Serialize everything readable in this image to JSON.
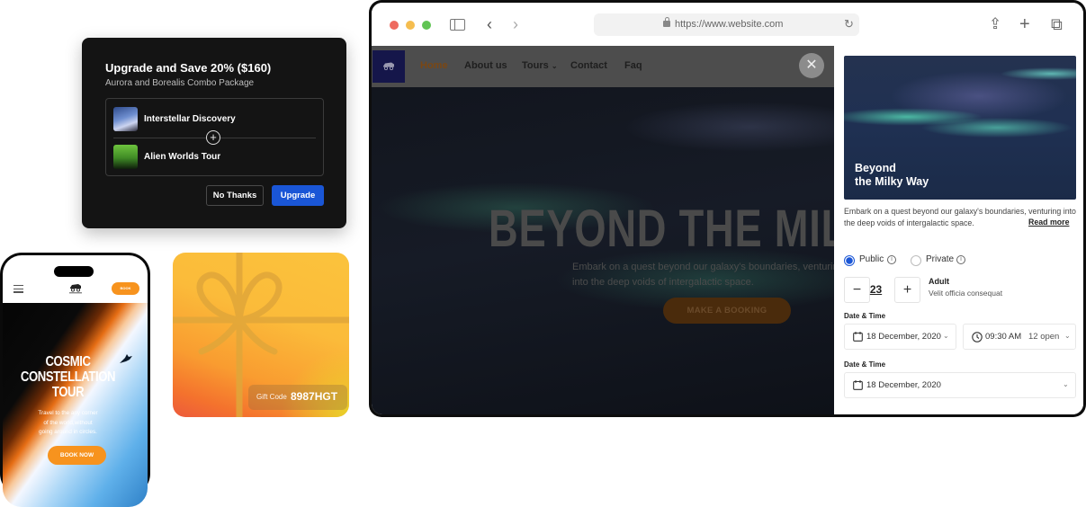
{
  "upgrade_card": {
    "title": "Upgrade and Save 20% ($160)",
    "subtitle": "Aurora and Borealis Combo Package",
    "items": [
      {
        "name": "Interstellar Discovery"
      },
      {
        "name": "Alien Worlds Tour"
      }
    ],
    "plus_symbol": "+",
    "no_thanks_label": "No Thanks",
    "upgrade_label": "Upgrade",
    "accent": "#1a56d6"
  },
  "phone": {
    "book_label": "BOOK",
    "hero_title_lines": [
      "COSMIC",
      "CONSTELLATION",
      "TOUR"
    ],
    "hero_subtitle_lines": [
      "Travel to the any corner",
      "of the world,without",
      "going around in circles."
    ],
    "book_now_label": "BOOK NOW",
    "accent": "#f7931e"
  },
  "gift_card": {
    "code_label": "Gift Code",
    "code_value": "8987HGT"
  },
  "browser": {
    "url": "https://www.website.com",
    "back_glyph": "‹",
    "forward_glyph": "›",
    "reload_glyph": "↻",
    "share_glyph": "⇪",
    "new_tab_glyph": "+",
    "tabs_glyph": "⧉",
    "site": {
      "nav": [
        "Home",
        "About us",
        "Tours",
        "Contact",
        "Faq"
      ],
      "tours_chevron": "⌄",
      "close_glyph": "✕",
      "hero_title": "BEYOND THE MILKY WAY",
      "hero_subtitle_lines": [
        "Embark on a quest beyond our galaxy's boundaries, venturing",
        "into the deep voids of intergalactic space."
      ],
      "cta_label": "MAKE A BOOKING"
    },
    "panel": {
      "image_caption_lines": [
        "Beyond",
        "the Milky Way"
      ],
      "description": "Embark on a quest beyond our galaxy's boundaries, venturing into the deep voids of intergalactic space.",
      "read_more": "Read more",
      "visibility_options": [
        {
          "label": "Public",
          "selected": true
        },
        {
          "label": "Private",
          "selected": false
        }
      ],
      "info_glyph": "i",
      "minus_glyph": "−",
      "plus_glyph": "+",
      "guest_count": "23",
      "guest_type": "Adult",
      "guest_desc": "Velit officia consequat",
      "date_time_label_1": "Date & Time",
      "date_1": "18 December, 2020",
      "time_1": "09:30 AM",
      "time_availability": "12 open",
      "date_time_label_2": "Date & Time",
      "date_2": "18 December, 2020",
      "chevron_glyph": "⌄"
    }
  }
}
